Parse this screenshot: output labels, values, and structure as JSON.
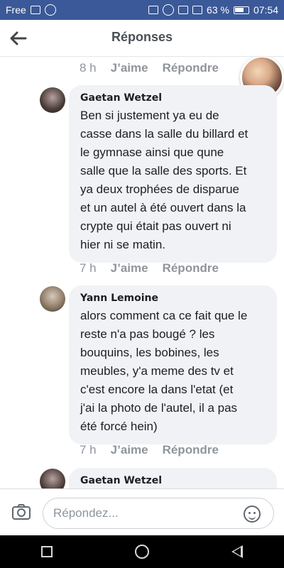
{
  "status": {
    "carrier": "Free",
    "battery": "63 %",
    "time": "07:54"
  },
  "header": {
    "title": "Réponses",
    "back_icon": "arrow-left-icon"
  },
  "actions": {
    "like": "J’aime",
    "reply": "Répondre"
  },
  "timestamps": [
    "8 h",
    "7 h",
    "7 h"
  ],
  "comments": [
    {
      "author": "Gaetan Wetzel",
      "text": "Ben si justement ya eu de\ncasse dans la salle du billard et\nle gymnase ainsi que qune\nsalle que la salle des sports. Et\nya deux trophées de disparue\net un autel à été ouvert dans la\ncrypte qui était pas ouvert ni\nhier ni se matin."
    },
    {
      "author": "Yann Lemoine",
      "text": "alors comment ca ce fait que le\nreste n'a pas bougé ? les\nbouquins, les bobines, les\nmeubles, y'a meme des tv et\nc'est encore la dans l'etat (et\nj'ai la photo de l'autel, il a pas\nété forcé hein)"
    },
    {
      "author": "Gaetan Wetzel",
      "text": ""
    }
  ],
  "composer": {
    "placeholder": "Répondez..."
  }
}
